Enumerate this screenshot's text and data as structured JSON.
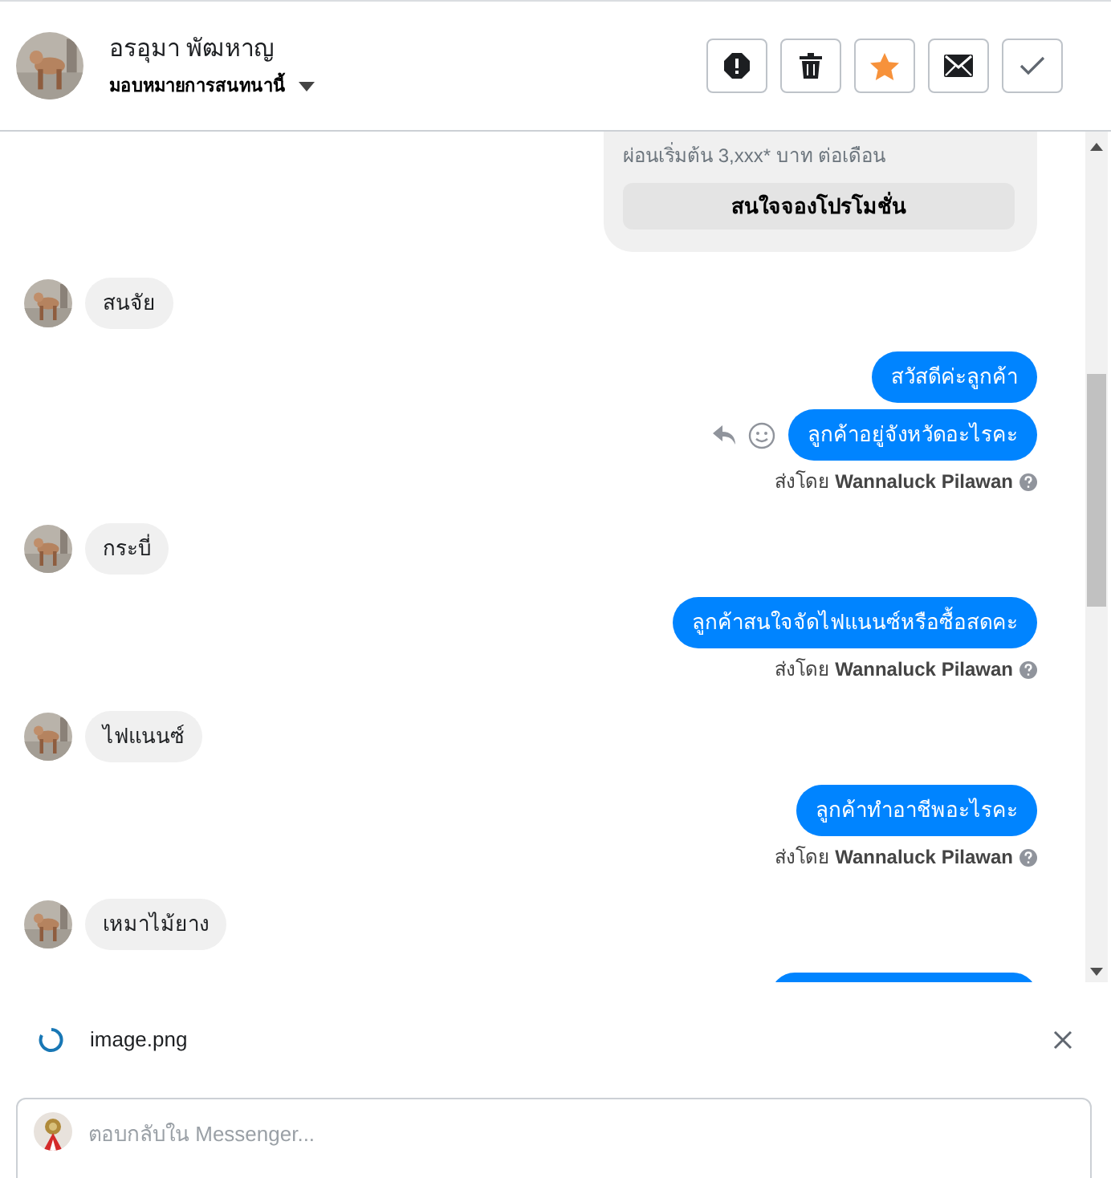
{
  "header": {
    "name": "อรอุมา พัฒหาญ",
    "assign_label": "มอบหมายการสนทนานี้",
    "actions": [
      {
        "kind": "spam",
        "selected": false
      },
      {
        "kind": "delete",
        "selected": false
      },
      {
        "kind": "star",
        "selected": true
      },
      {
        "kind": "unread",
        "selected": false
      },
      {
        "kind": "done",
        "selected": false
      }
    ]
  },
  "promo_card": {
    "subtitle": "ผ่อนเริ่มต้น 3,xxx* บาท ต่อเดือน",
    "button": "สนใจจองโปรโมชั่น"
  },
  "messages": [
    {
      "kind": "incoming",
      "text": "สนจัย"
    },
    {
      "kind": "outgoing",
      "text": "สวัสดีค่ะลูกค้า",
      "hovered": false
    },
    {
      "kind": "outgoing",
      "text": "ลูกค้าอยู่จังหวัดอะไรคะ",
      "hovered": true
    },
    {
      "kind": "sent_by",
      "text": "ส่งโดย **Wannaluck Pilawan**"
    },
    {
      "kind": "incoming",
      "text": "กระบี่"
    },
    {
      "kind": "outgoing",
      "text": "ลูกค้าสนใจจัดไฟแนนซ์หรือซื้อสดคะ",
      "hovered": false
    },
    {
      "kind": "sent_by",
      "text": "ส่งโดย **Wannaluck Pilawan**"
    },
    {
      "kind": "incoming",
      "text": "ไฟแนนซ์"
    },
    {
      "kind": "outgoing",
      "text": "ลูกค้าทำอาชีพอะไรคะ",
      "hovered": false
    },
    {
      "kind": "sent_by",
      "text": "ส่งโดย **Wannaluck Pilawan**"
    },
    {
      "kind": "incoming",
      "text": "เหมาไม้ยาง"
    }
  ],
  "attachment": {
    "filename": "image.png"
  },
  "composer": {
    "placeholder": "ตอบกลับใน Messenger..."
  }
}
